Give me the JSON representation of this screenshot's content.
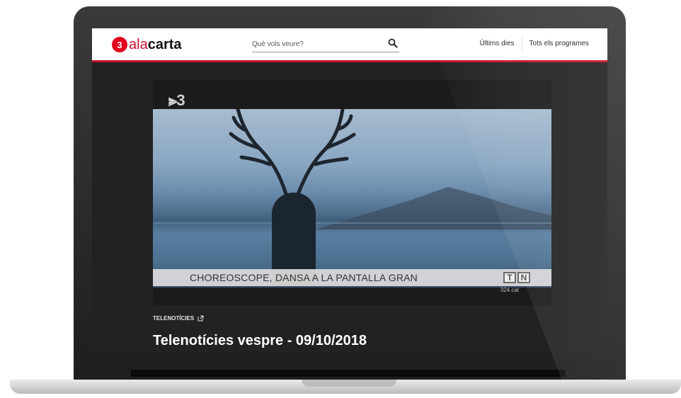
{
  "header": {
    "logo_badge": "3",
    "logo_prefix": "ala",
    "logo_suffix": "carta",
    "search_placeholder": "Què vols veure?",
    "nav": [
      "Últims dies",
      "Tots els programes"
    ]
  },
  "player": {
    "channel_mark": "⫸3",
    "caption": "CHOREOSCOPE, DANSA A LA PANTALLA GRAN",
    "tn_letters": [
      "T",
      "N"
    ],
    "site": "324.cat"
  },
  "program": {
    "label": "TELENOTÍCIES",
    "title": "Telenotícies vespre - 09/10/2018"
  },
  "colors": {
    "brand": "#c8102e",
    "logo_red": "#e3001b",
    "screen_bg": "#222222"
  },
  "icons": {
    "search": "search-icon",
    "external_link": "external-link-icon"
  }
}
